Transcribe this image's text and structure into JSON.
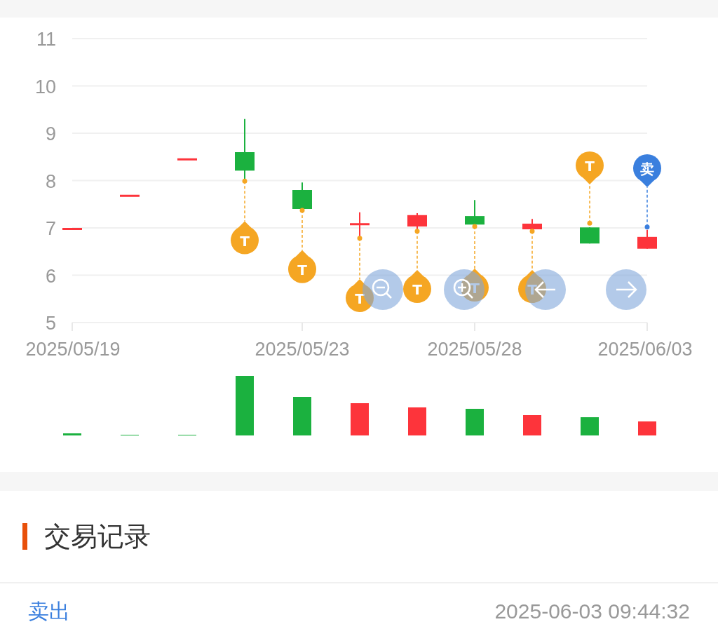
{
  "chart": {
    "y_axis_labels": [
      "11",
      "10",
      "9",
      "8",
      "7",
      "6",
      "5"
    ],
    "x_axis_labels": [
      "2025/05/19",
      "2025/05/23",
      "2025/05/28",
      "2025/06/03"
    ],
    "markers": [
      {
        "label": "T",
        "color": "#f5a623"
      },
      {
        "label": "T",
        "color": "#f5a623"
      },
      {
        "label": "T",
        "color": "#f5a623"
      },
      {
        "label": "T",
        "color": "#f5a623"
      },
      {
        "label": "T",
        "color": "#f5a623"
      },
      {
        "label": "T",
        "color": "#f5a623"
      },
      {
        "label": "T",
        "color": "#f5a623"
      },
      {
        "label": "卖",
        "color": "#3a7fde"
      }
    ]
  },
  "section": {
    "title": "交易记录"
  },
  "records": [
    {
      "action": "卖出",
      "time": "2025-06-03 09:44:32"
    }
  ]
}
